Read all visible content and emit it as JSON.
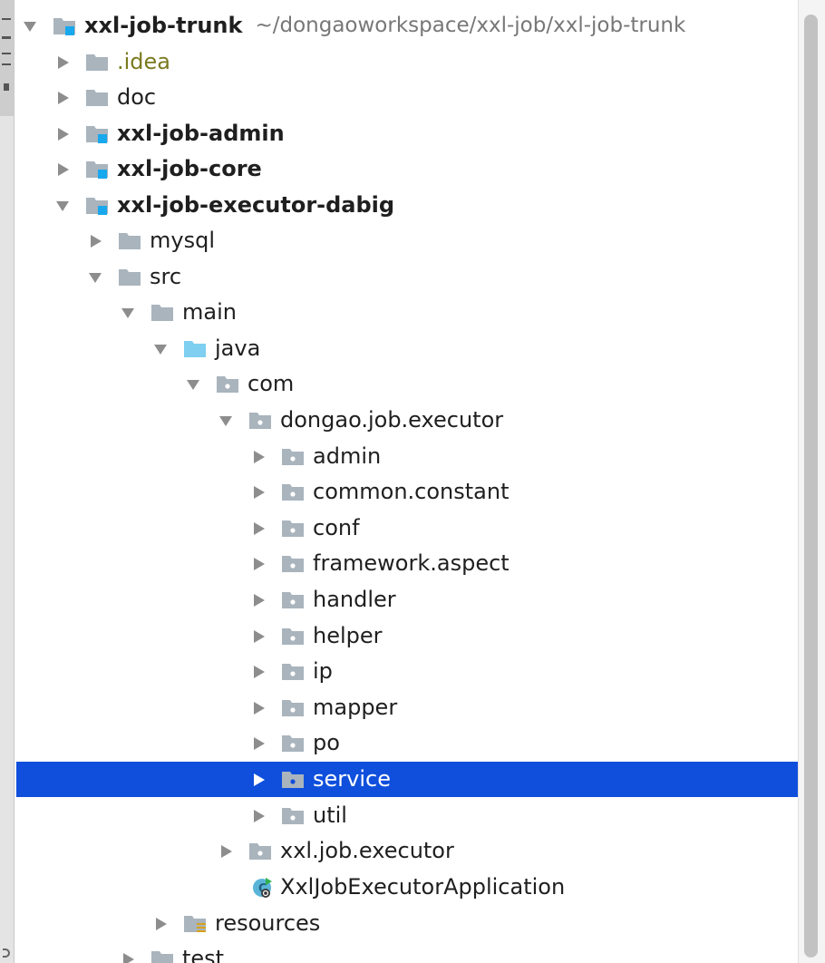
{
  "tree": {
    "root": {
      "label": "xxl-job-trunk",
      "path_hint": "~/dongaoworkspace/xxl-job/xxl-job-trunk"
    },
    "items": [
      {
        "label": ".idea"
      },
      {
        "label": "doc"
      },
      {
        "label": "xxl-job-admin"
      },
      {
        "label": "xxl-job-core"
      },
      {
        "label": "xxl-job-executor-dabig"
      },
      {
        "label": "mysql"
      },
      {
        "label": "src"
      },
      {
        "label": "main"
      },
      {
        "label": "java"
      },
      {
        "label": "com"
      },
      {
        "label": "dongao.job.executor"
      },
      {
        "label": "admin"
      },
      {
        "label": "common.constant"
      },
      {
        "label": "conf"
      },
      {
        "label": "framework.aspect"
      },
      {
        "label": "handler"
      },
      {
        "label": "helper"
      },
      {
        "label": "ip"
      },
      {
        "label": "mapper"
      },
      {
        "label": "po"
      },
      {
        "label": "service"
      },
      {
        "label": "util"
      },
      {
        "label": "xxl.job.executor"
      },
      {
        "label": "XxlJobExecutorApplication"
      },
      {
        "label": "resources"
      },
      {
        "label": "test"
      }
    ]
  },
  "colors": {
    "selection": "#0f4fdc",
    "folder": "#a9b4bd",
    "source_folder": "#7ecff0",
    "module_badge": "#18a8ee",
    "idea_text": "#7a7a20",
    "path_hint": "#777777"
  }
}
